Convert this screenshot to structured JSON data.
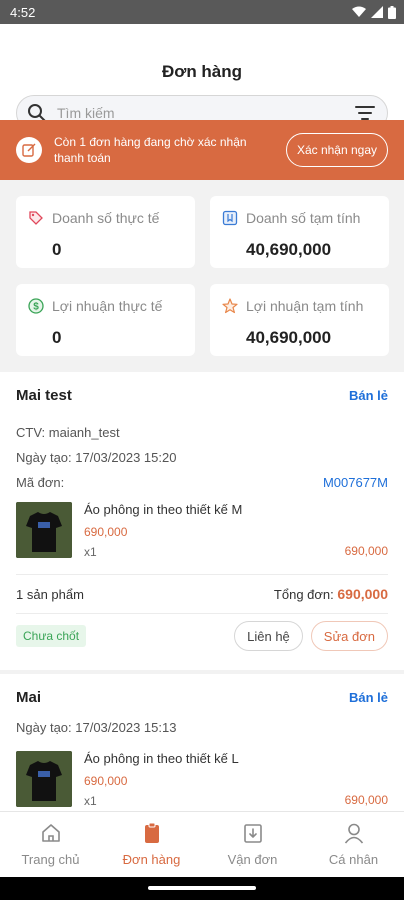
{
  "status_bar": {
    "time": "4:52"
  },
  "header": {
    "title": "Đơn hàng",
    "search_placeholder": "Tìm kiếm"
  },
  "banner": {
    "message": "Còn 1 đơn hàng đang chờ xác nhận thanh toán",
    "action_label": "Xác nhận ngay"
  },
  "stats": [
    {
      "label": "Doanh số thực tế",
      "value": "0",
      "icon": "tag-icon",
      "color": "#e0475b"
    },
    {
      "label": "Doanh số tạm tính",
      "value": "40,690,000",
      "icon": "bookmark-icon",
      "color": "#3a7bd5"
    },
    {
      "label": "Lợi nhuận thực tế",
      "value": "0",
      "icon": "dollar-icon",
      "color": "#3aa457"
    },
    {
      "label": "Lợi nhuận tạm tính",
      "value": "40,690,000",
      "icon": "star-icon",
      "color": "#e8864a"
    }
  ],
  "orders": [
    {
      "customer": "Mai test",
      "type": "Bán lẻ",
      "ctv": "CTV: maianh_test",
      "created": "Ngày tạo: 17/03/2023 15:20",
      "code_label": "Mã đơn:",
      "code": "M007677M",
      "product": {
        "name": "Áo phông in theo thiết kế M",
        "price": "690,000",
        "qty": "x1",
        "line_total": "690,000"
      },
      "count": "1 sản phẩm",
      "total_label": "Tổng đơn:",
      "total": "690,000",
      "status": "Chưa chốt",
      "contact_label": "Liên hệ",
      "edit_label": "Sửa đơn"
    },
    {
      "customer": "Mai",
      "type": "Bán lẻ",
      "created": "Ngày tạo: 17/03/2023 15:13",
      "product": {
        "name": "Áo phông in theo thiết kế L",
        "price": "690,000",
        "qty": "x1",
        "line_total": "690,000"
      }
    }
  ],
  "tabs": [
    {
      "label": "Trang chủ",
      "icon": "home-icon",
      "active": false
    },
    {
      "label": "Đơn hàng",
      "icon": "clipboard-icon",
      "active": true
    },
    {
      "label": "Vận đơn",
      "icon": "delivery-icon",
      "active": false
    },
    {
      "label": "Cá nhân",
      "icon": "user-icon",
      "active": false
    }
  ],
  "colors": {
    "accent": "#d86a41",
    "link": "#1e6fd9",
    "success": "#3aa457"
  }
}
